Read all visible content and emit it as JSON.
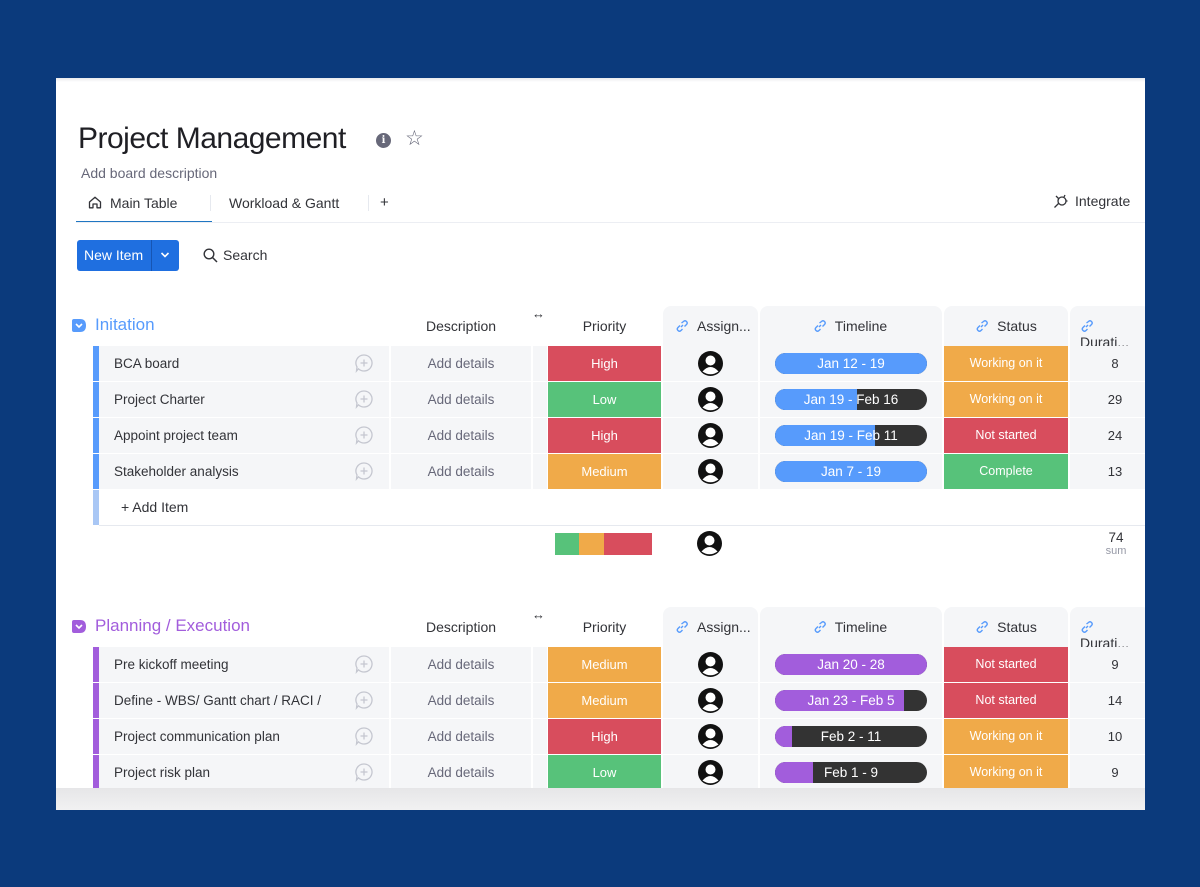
{
  "board": {
    "title": "Project Management",
    "description_placeholder": "Add board description",
    "info_icon": "info-icon",
    "star_icon": "star-icon"
  },
  "tabs": [
    {
      "label": "Main Table",
      "icon": "home-icon",
      "active": true
    },
    {
      "label": "Workload & Gantt",
      "active": false
    },
    {
      "label": "+",
      "icon": "plus-icon"
    }
  ],
  "integrate": {
    "label": "Integrate",
    "icon": "integrate-icon"
  },
  "toolbar": {
    "new_item_label": "New Item",
    "search_label": "Search"
  },
  "columns": {
    "description": "Description",
    "priority": "Priority",
    "assignee": "Assign...",
    "timeline": "Timeline",
    "status": "Status",
    "duration": "Durati..."
  },
  "colors": {
    "high": "#d84d5d",
    "low": "#57c27a",
    "medium": "#f0aa49",
    "working": "#f0aa49",
    "not_started": "#d84d5d",
    "complete": "#57c27a",
    "group1": "#579bfc",
    "group2": "#a25ddc",
    "timeline_rest": "#333333"
  },
  "groups": [
    {
      "title": "Initation",
      "color": "#579bfc",
      "add_item_label": "+ Add Item",
      "items": [
        {
          "name": "BCA board",
          "description": "Add details",
          "priority": "High",
          "timeline": "Jan 12 - 19",
          "timeline_progress": 1.0,
          "status": "Working on it",
          "duration": "8"
        },
        {
          "name": "Project Charter",
          "description": "Add details",
          "priority": "Low",
          "timeline": "Jan 19 - Feb 16",
          "timeline_progress": 0.54,
          "status": "Working on it",
          "duration": "29"
        },
        {
          "name": "Appoint project team",
          "description": "Add details",
          "priority": "High",
          "timeline": "Jan 19 - Feb 11",
          "timeline_progress": 0.66,
          "status": "Not started",
          "duration": "24"
        },
        {
          "name": "Stakeholder analysis",
          "description": "Add details",
          "priority": "Medium",
          "timeline": "Jan 7 - 19",
          "timeline_progress": 1.0,
          "status": "Complete",
          "duration": "13"
        }
      ],
      "summary": {
        "priority_distribution": [
          {
            "label": "Low",
            "fraction": 0.25
          },
          {
            "label": "Medium",
            "fraction": 0.25
          },
          {
            "label": "High",
            "fraction": 0.5
          }
        ],
        "duration_sum": "74",
        "duration_sum_label": "sum"
      }
    },
    {
      "title": "Planning / Execution",
      "color": "#a25ddc",
      "items": [
        {
          "name": "Pre kickoff meeting",
          "description": "Add details",
          "priority": "Medium",
          "timeline": "Jan 20 - 28",
          "timeline_progress": 1.0,
          "status": "Not started",
          "duration": "9"
        },
        {
          "name": "Define - WBS/ Gantt chart / RACI /",
          "description": "Add details",
          "priority": "Medium",
          "timeline": "Jan 23 - Feb 5",
          "timeline_progress": 0.85,
          "status": "Not started",
          "duration": "14"
        },
        {
          "name": "Project communication plan",
          "description": "Add details",
          "priority": "High",
          "timeline": "Feb 2 - 11",
          "timeline_progress": 0.11,
          "status": "Working on it",
          "duration": "10"
        },
        {
          "name": "Project risk plan",
          "description": "Add details",
          "priority": "Low",
          "timeline": "Feb 1 - 9",
          "timeline_progress": 0.25,
          "status": "Working on it",
          "duration": "9"
        }
      ]
    }
  ]
}
